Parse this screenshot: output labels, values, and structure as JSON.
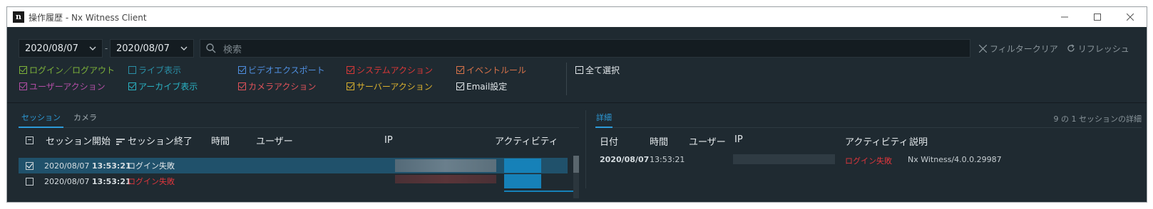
{
  "window": {
    "title": "操作履歴 - Nx Witness Client",
    "logo_text": "n"
  },
  "toolbar": {
    "date_from": "2020/08/07",
    "date_to": "2020/08/07",
    "date_separator": "-",
    "search_placeholder": "検索",
    "clear_filter": "フィルタークリア",
    "refresh": "リフレッシュ"
  },
  "filters": [
    {
      "label": "ログイン／ログアウト",
      "color": "#7db23a",
      "checked": true
    },
    {
      "label": "ユーザーアクション",
      "color": "#b34ea6",
      "checked": true
    },
    {
      "label": "ライブ表示",
      "color": "#2a8fa6",
      "checked": false
    },
    {
      "label": "アーカイブ表示",
      "color": "#2ab3c4",
      "checked": true
    },
    {
      "label": "ビデオエクスポート",
      "color": "#4f8fe0",
      "checked": true
    },
    {
      "label": "カメラアクション",
      "color": "#e0525a",
      "checked": true
    },
    {
      "label": "システムアクション",
      "color": "#d93838",
      "checked": true
    },
    {
      "label": "サーバーアクション",
      "color": "#d9b02e",
      "checked": true
    },
    {
      "label": "イベントルール",
      "color": "#d9734a",
      "checked": true
    },
    {
      "label": "Email設定",
      "color": "#e3e8eb",
      "checked": true
    },
    {
      "label": "全て選択",
      "color": "#e3e8eb",
      "checked": false
    }
  ],
  "sessions": {
    "tabs": [
      "セッション",
      "カメラ"
    ],
    "columns": [
      "セッション開始",
      "セッション終了",
      "時間",
      "ユーザー",
      "IP",
      "アクティビティ"
    ],
    "rows": [
      {
        "date": "2020/08/07",
        "time": "13:53:21",
        "end": "ログイン失敗",
        "checked": true,
        "selected": true
      },
      {
        "date": "2020/08/07",
        "time": "13:53:21",
        "end": "ログイン失敗",
        "checked": false,
        "selected": false
      }
    ]
  },
  "details": {
    "tab": "詳細",
    "count_text": "9 の 1 セッションの詳細",
    "columns": [
      "日付",
      "時間",
      "ユーザー",
      "IP",
      "アクティビティ",
      "説明"
    ],
    "row": {
      "date": "2020/08/07",
      "time": "13:53:21",
      "activity": "ログイン失敗",
      "description": "Nx Witness/4.0.0.29987"
    }
  }
}
